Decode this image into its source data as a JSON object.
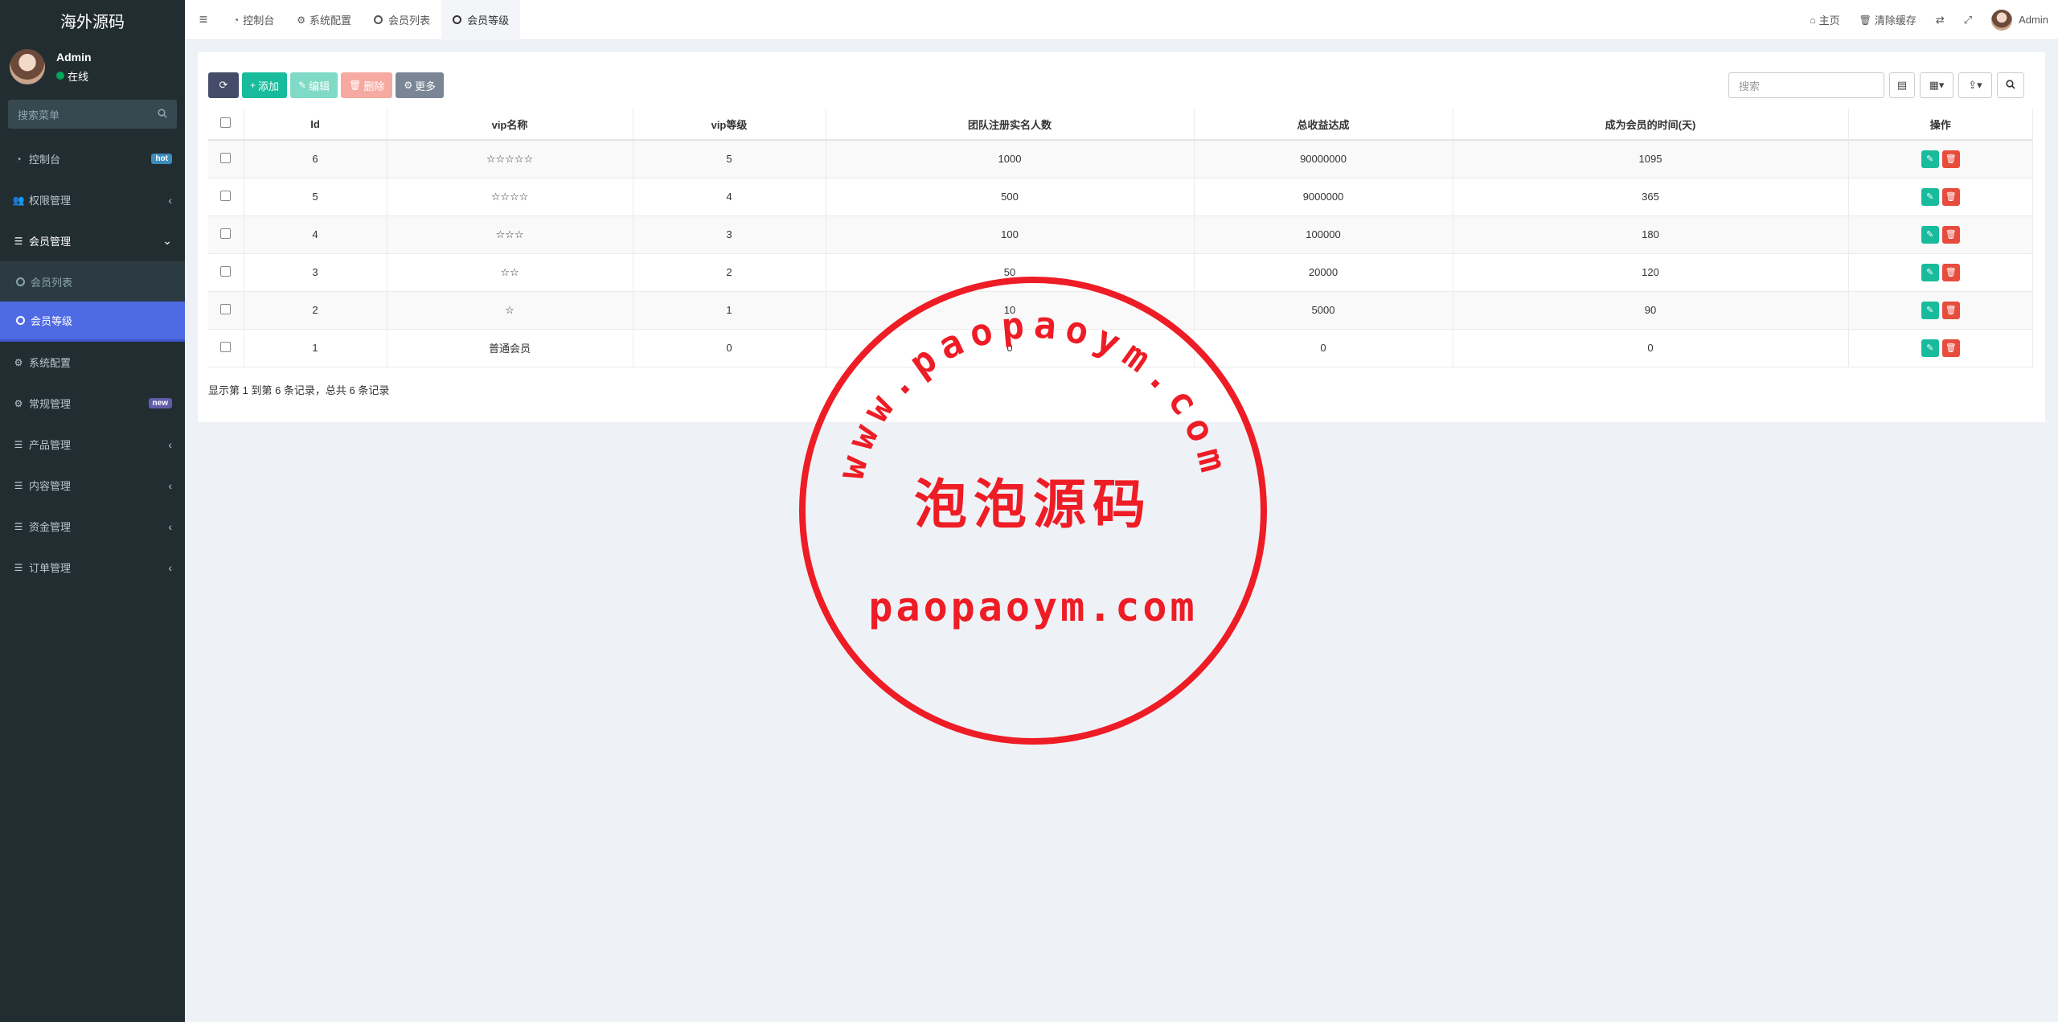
{
  "app": {
    "brand": "海外源码"
  },
  "user": {
    "name": "Admin",
    "status": "在线"
  },
  "sidebar": {
    "search_placeholder": "搜索菜单",
    "items": [
      {
        "label": "控制台",
        "icon": "dashboard-icon",
        "badge": "hot"
      },
      {
        "label": "权限管理",
        "icon": "users-icon"
      },
      {
        "label": "会员管理",
        "icon": "list-icon",
        "open": true,
        "children": [
          {
            "label": "会员列表"
          },
          {
            "label": "会员等级",
            "active": true
          }
        ]
      },
      {
        "label": "系统配置",
        "icon": "gear-icon"
      },
      {
        "label": "常规管理",
        "icon": "cogs-icon",
        "badge": "new"
      },
      {
        "label": "产品管理",
        "icon": "list-icon"
      },
      {
        "label": "内容管理",
        "icon": "list-icon"
      },
      {
        "label": "资金管理",
        "icon": "list-icon"
      },
      {
        "label": "订单管理",
        "icon": "list-icon"
      }
    ]
  },
  "tabs": [
    {
      "label": "控制台",
      "icon": "dashboard-icon"
    },
    {
      "label": "系统配置",
      "icon": "gear-icon"
    },
    {
      "label": "会员列表",
      "icon": "circle-icon"
    },
    {
      "label": "会员等级",
      "icon": "circle-icon",
      "active": true
    }
  ],
  "topbar_right": {
    "home": "主页",
    "clear_cache": "清除缓存",
    "user": "Admin"
  },
  "toolbar": {
    "add": "添加",
    "edit": "编辑",
    "delete": "删除",
    "more": "更多",
    "search_placeholder": "搜索"
  },
  "table": {
    "columns": [
      "Id",
      "vip名称",
      "vip等级",
      "团队注册实名人数",
      "总收益达成",
      "成为会员的时间(天)",
      "操作"
    ],
    "rows": [
      [
        "6",
        "☆☆☆☆☆",
        "5",
        "1000",
        "90000000",
        "1095"
      ],
      [
        "5",
        "☆☆☆☆",
        "4",
        "500",
        "9000000",
        "365"
      ],
      [
        "4",
        "☆☆☆",
        "3",
        "100",
        "100000",
        "180"
      ],
      [
        "3",
        "☆☆",
        "2",
        "50",
        "20000",
        "120"
      ],
      [
        "2",
        "☆",
        "1",
        "10",
        "5000",
        "90"
      ],
      [
        "1",
        "普通会员",
        "0",
        "0",
        "0",
        "0"
      ]
    ]
  },
  "summary": "显示第 1 到第 6 条记录，总共 6 条记录",
  "watermark": {
    "arc_text": "www.paopaoym.com",
    "title": "泡泡源码",
    "url": "paopaoym.com",
    "color": "#ee1c25"
  },
  "colors": {
    "sidebar_bg": "#222d32",
    "active_menu": "#4f6be3",
    "add_button": "#18bc9c",
    "delete_button": "#e74c3c"
  }
}
